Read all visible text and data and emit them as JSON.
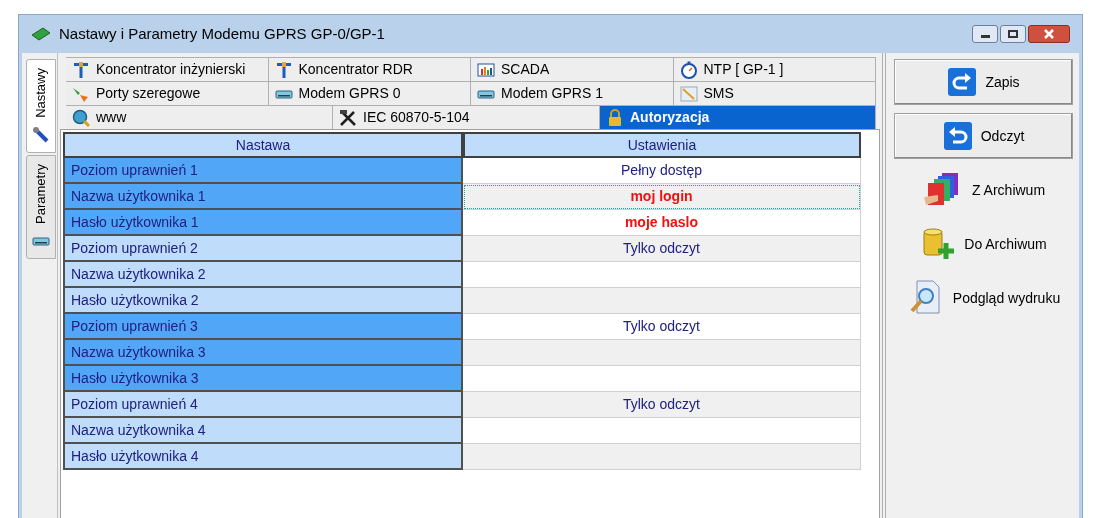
{
  "window": {
    "title": "Nastawy i Parametry Modemu GPRS GP-0/GP-1"
  },
  "side_tabs": [
    {
      "label": "Nastawy",
      "selected": true
    },
    {
      "label": "Parametry",
      "selected": false
    }
  ],
  "tab_rows": [
    [
      {
        "label": "Koncentrator inżynierski",
        "selected": false
      },
      {
        "label": "Koncentrator RDR",
        "selected": false
      },
      {
        "label": "SCADA",
        "selected": false
      },
      {
        "label": "NTP  [ GP-1 ]",
        "selected": false
      }
    ],
    [
      {
        "label": "Porty szeregowe",
        "selected": false
      },
      {
        "label": "Modem GPRS 0",
        "selected": false
      },
      {
        "label": "Modem GPRS 1",
        "selected": false
      },
      {
        "label": "SMS",
        "selected": false
      }
    ],
    [
      {
        "label": "www",
        "selected": false
      },
      {
        "label": "IEC 60870-5-104",
        "selected": false
      },
      {
        "label": "Autoryzacja",
        "selected": true
      }
    ]
  ],
  "table": {
    "columns": [
      "Nastawa",
      "Ustawienia"
    ],
    "rows": [
      {
        "name": "Poziom uprawnień 1",
        "value": "Pełny dostęp",
        "highlighted": true,
        "emphasis": false,
        "focused": false
      },
      {
        "name": "Nazwa użytkownika 1",
        "value": "moj login",
        "highlighted": true,
        "emphasis": true,
        "focused": true
      },
      {
        "name": "Hasło użytkownika 1",
        "value": "moje haslo",
        "highlighted": true,
        "emphasis": true,
        "focused": false
      },
      {
        "name": "Poziom uprawnień 2",
        "value": "Tylko odczyt",
        "highlighted": false,
        "emphasis": false,
        "focused": false
      },
      {
        "name": "Nazwa użytkownika 2",
        "highlighted": false,
        "focused": false
      },
      {
        "name": "Hasło użytkownika 2",
        "highlighted": false,
        "focused": false
      },
      {
        "name": "Poziom uprawnień 3",
        "value": "Tylko odczyt",
        "highlighted": true,
        "emphasis": false,
        "focused": false
      },
      {
        "name": "Nazwa użytkownika 3",
        "highlighted": true,
        "focused": false
      },
      {
        "name": "Hasło użytkownika 3",
        "highlighted": true,
        "focused": false
      },
      {
        "name": "Poziom uprawnień 4",
        "value": "Tylko odczyt",
        "highlighted": false,
        "emphasis": false,
        "focused": false
      },
      {
        "name": "Nazwa użytkownika 4",
        "highlighted": false,
        "focused": false
      },
      {
        "name": "Hasło użytkownika 4",
        "highlighted": false,
        "focused": false
      }
    ]
  },
  "actions": [
    {
      "label": "Zapis",
      "kind": "button"
    },
    {
      "label": "Odczyt",
      "kind": "button"
    },
    {
      "label": "Z Archiwum",
      "kind": "link"
    },
    {
      "label": "Do Archiwum",
      "kind": "link"
    },
    {
      "label": "Podgląd wydruku",
      "kind": "link"
    }
  ]
}
